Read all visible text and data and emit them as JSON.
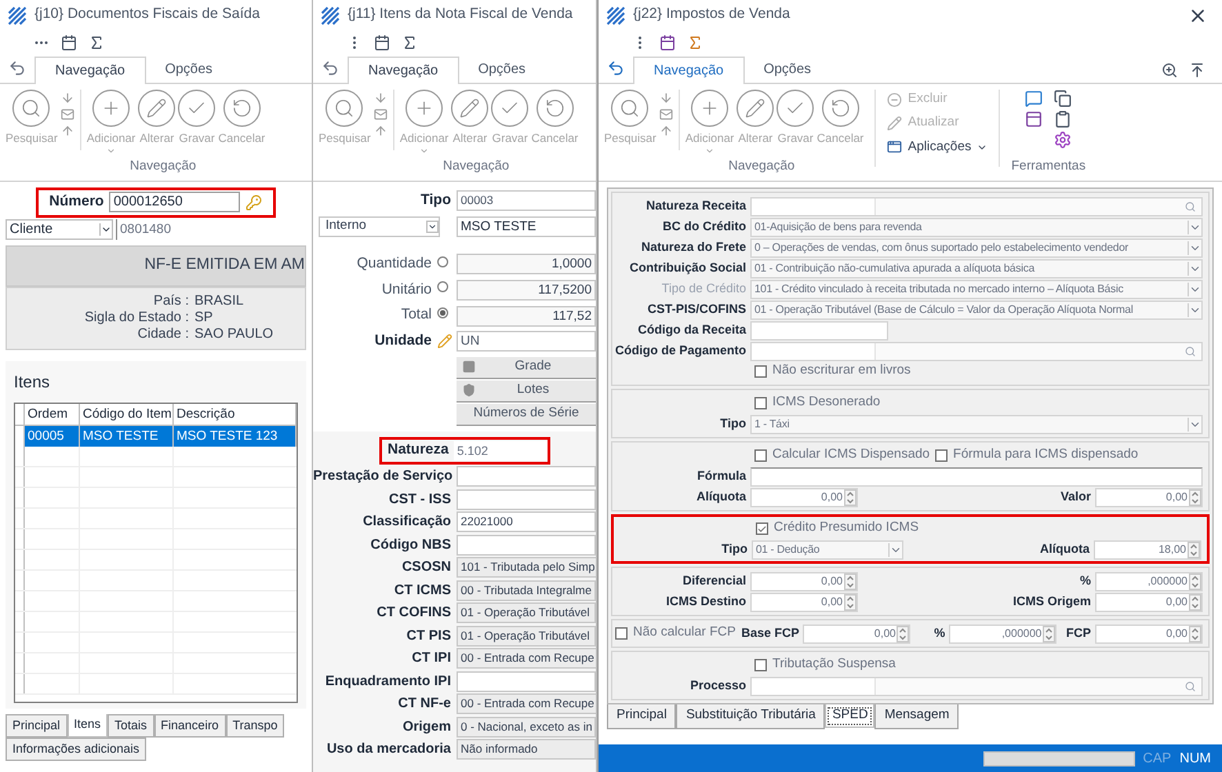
{
  "documents_window": {
    "title": "{j10} Documentos Fiscais de Saída",
    "ribbon": {
      "tabs": [
        {
          "label": "Navegação",
          "selected": true
        },
        {
          "label": "Opções",
          "selected": false
        }
      ],
      "buttons": [
        "Pesquisar",
        "Adicionar",
        "Alterar",
        "Gravar",
        "Cancelar"
      ],
      "group": "Navegação"
    },
    "number": {
      "label": "Número",
      "value": "000012650",
      "highlighted": true
    },
    "party": {
      "selector": "Cliente",
      "value": "0801480"
    },
    "banner": "NF-E EMITIDA EM AM",
    "address": [
      {
        "label": "País :",
        "value": "BRASIL"
      },
      {
        "label": "Sigla do Estado :",
        "value": "SP"
      },
      {
        "label": "Cidade :",
        "value": "SAO PAULO"
      }
    ],
    "items": {
      "title": "Itens",
      "columns": [
        "Ordem",
        "Código do Item",
        "Descrição"
      ],
      "rows": [
        {
          "cells": [
            "00005",
            "MSO TESTE",
            "MSO TESTE 123"
          ],
          "selected": true
        }
      ]
    },
    "tabs": [
      {
        "label": "Principal",
        "selected": false
      },
      {
        "label": "Itens",
        "selected": true
      },
      {
        "label": "Totais",
        "selected": false
      },
      {
        "label": "Financeiro",
        "selected": false
      },
      {
        "label": "Transpo",
        "selected": false
      },
      {
        "label": "Informações adicionais",
        "selected": false
      }
    ]
  },
  "items_window": {
    "title": "{j11} Itens da Nota Fiscal de Venda",
    "ribbon": {
      "tabs": [
        {
          "label": "Navegação",
          "selected": true
        },
        {
          "label": "Opções",
          "selected": false
        }
      ],
      "buttons": [
        "Pesquisar",
        "Adicionar",
        "Alterar",
        "Gravar",
        "Cancelar"
      ],
      "group": "Navegação"
    },
    "tipo": {
      "label": "Tipo",
      "value": "00003"
    },
    "origin": {
      "selector": "Interno",
      "value": "MSO TESTE"
    },
    "quantities": [
      {
        "label": "Quantidade",
        "value": "1,0000",
        "selected": false
      },
      {
        "label": "Unitário",
        "value": "117,5200",
        "selected": false
      },
      {
        "label": "Total",
        "value": "117,52",
        "selected": true
      }
    ],
    "unit": {
      "label": "Unidade",
      "value": "UN"
    },
    "buttons": [
      "Grade",
      "Lotes",
      "Números de Série"
    ],
    "nature": {
      "label": "Natureza",
      "value": "5.102",
      "highlighted": true
    },
    "fields": [
      {
        "label": "Prestação de Serviço",
        "disabled": false
      },
      {
        "label": "CST - ISS",
        "disabled": false
      },
      {
        "label": "Classificação",
        "value": "22021000",
        "disabled": false
      },
      {
        "label": "Código NBS",
        "disabled": false
      },
      {
        "label": "CSOSN",
        "value": "101 - Tributada pelo Simp",
        "disabled": true
      },
      {
        "label": "CT ICMS",
        "value": "00 - Tributada Integralme",
        "disabled": true
      },
      {
        "label": "CT COFINS",
        "value": "01 - Operação Tributável",
        "disabled": true
      },
      {
        "label": "CT PIS",
        "value": "01 - Operação Tributável",
        "disabled": true
      },
      {
        "label": "CT IPI",
        "value": "00 - Entrada com Recupe",
        "disabled": true
      },
      {
        "label": "Enquadramento IPI",
        "disabled": false
      },
      {
        "label": "CT NF-e",
        "value": "00 - Entrada com Recupe",
        "disabled": true
      },
      {
        "label": "Origem",
        "value": "0 - Nacional, exceto as in",
        "disabled": true
      },
      {
        "label": "Uso da mercadoria",
        "value": "Não informado",
        "disabled": true
      }
    ]
  },
  "taxes_window": {
    "title": "{j22} Impostos de Venda",
    "ribbon": {
      "tabs": [
        {
          "label": "Navegação",
          "selected": true
        },
        {
          "label": "Opções",
          "selected": false
        }
      ],
      "buttons": [
        "Pesquisar",
        "Adicionar",
        "Alterar",
        "Gravar",
        "Cancelar"
      ],
      "group": "Navegação",
      "actions": [
        {
          "label": "Excluir",
          "disabled": true
        },
        {
          "label": "Atualizar",
          "disabled": true
        },
        {
          "label": "Aplicações",
          "disabled": false
        }
      ],
      "tools_group": "Ferramentas"
    },
    "sections": [
      {
        "highlighted": false,
        "rows": [
          [
            {
              "kind": "lookup",
              "label": "Natureza Receita",
              "disabled": false
            }
          ],
          [
            {
              "kind": "select",
              "label": "BC do Crédito",
              "value": "01-Aquisição de bens para revenda",
              "disabled": false
            }
          ],
          [
            {
              "kind": "select",
              "label": "Natureza do Frete",
              "value": "0 – Operações de vendas, com ônus suportado pelo estabelecimento vendedor",
              "disabled": false
            }
          ],
          [
            {
              "kind": "select",
              "label": "Contribuição Social",
              "value": "01 - Contribuição não-cumulativa apurada a alíquota básica",
              "disabled": false
            }
          ],
          [
            {
              "kind": "select",
              "label": "Tipo de Crédito",
              "value": "101 - Crédito vinculado à receita tributada no mercado interno – Alíquota Básic",
              "disabled": true
            }
          ],
          [
            {
              "kind": "select",
              "label": "CST-PIS/COFINS",
              "value": "01 - Operação Tributável (Base de Cálculo = Valor da Operação Alíquota Normal",
              "disabled": false
            }
          ],
          [
            {
              "kind": "text",
              "label": "Código da Receita",
              "disabled": false
            }
          ],
          [
            {
              "kind": "lookup",
              "label": "Código de Pagamento",
              "disabled": false
            }
          ],
          [
            {
              "kind": "check",
              "label": "Não escriturar em livros",
              "checked": false
            }
          ]
        ]
      },
      {
        "highlighted": false,
        "rows": [
          [
            {
              "kind": "check",
              "label": "ICMS Desonerado",
              "checked": false
            }
          ],
          [
            {
              "kind": "select",
              "label": "Tipo",
              "value": "1 - Táxi",
              "disabled": false
            }
          ]
        ]
      },
      {
        "highlighted": false,
        "rows": [
          [
            {
              "kind": "check",
              "label": "Calcular ICMS Dispensado",
              "checked": false
            },
            {
              "kind": "check",
              "label": "Fórmula para ICMS dispensado",
              "checked": false
            }
          ],
          [
            {
              "kind": "line",
              "label": "Fórmula",
              "disabled": false
            }
          ],
          [
            {
              "kind": "spin",
              "label": "Alíquota",
              "value": "0,00",
              "disabled": false
            },
            {
              "kind": "spin",
              "label": "Valor",
              "value": "0,00",
              "disabled": false
            }
          ]
        ]
      },
      {
        "highlighted": true,
        "rows": [
          [
            {
              "kind": "check",
              "label": "Crédito Presumido ICMS",
              "checked": true
            }
          ],
          [
            {
              "kind": "select",
              "label": "Tipo",
              "value": "01 - Dedução",
              "disabled": false
            },
            {
              "kind": "spin",
              "label": "Alíquota",
              "value": "18,00",
              "disabled": false
            }
          ]
        ]
      },
      {
        "highlighted": false,
        "rows": [
          [
            {
              "kind": "spin",
              "label": "Diferencial",
              "value": "0,00",
              "disabled": false
            },
            {
              "kind": "spin",
              "label": "%",
              "value": ",000000",
              "disabled": false
            }
          ],
          [
            {
              "kind": "spin",
              "label": "ICMS Destino",
              "value": "0,00",
              "disabled": false
            },
            {
              "kind": "spin",
              "label": "ICMS Origem",
              "value": "0,00",
              "disabled": false
            }
          ]
        ]
      },
      {
        "highlighted": false,
        "rows": [
          [
            {
              "kind": "check",
              "label": "Não calcular FCP",
              "checked": false
            },
            {
              "kind": "spin",
              "label": "Base FCP",
              "value": "0,00",
              "disabled": false
            },
            {
              "kind": "spin",
              "label": "%",
              "value": ",000000",
              "disabled": false
            },
            {
              "kind": "spin",
              "label": "FCP",
              "value": "0,00",
              "disabled": false
            }
          ]
        ]
      },
      {
        "highlighted": false,
        "rows": [
          [
            {
              "kind": "check",
              "label": "Tributação Suspensa",
              "checked": false
            }
          ],
          [
            {
              "kind": "lookup",
              "label": "Processo",
              "disabled": false
            }
          ]
        ]
      }
    ],
    "tabs": [
      {
        "label": "Principal",
        "selected": false
      },
      {
        "label": "Substituição Tributária",
        "selected": false
      },
      {
        "label": "SPED",
        "selected": true
      },
      {
        "label": "Mensagem",
        "selected": false
      }
    ]
  },
  "status_bar": {
    "indicators": [
      {
        "label": "CAP",
        "active": false
      },
      {
        "label": "NUM",
        "active": true
      }
    ]
  }
}
